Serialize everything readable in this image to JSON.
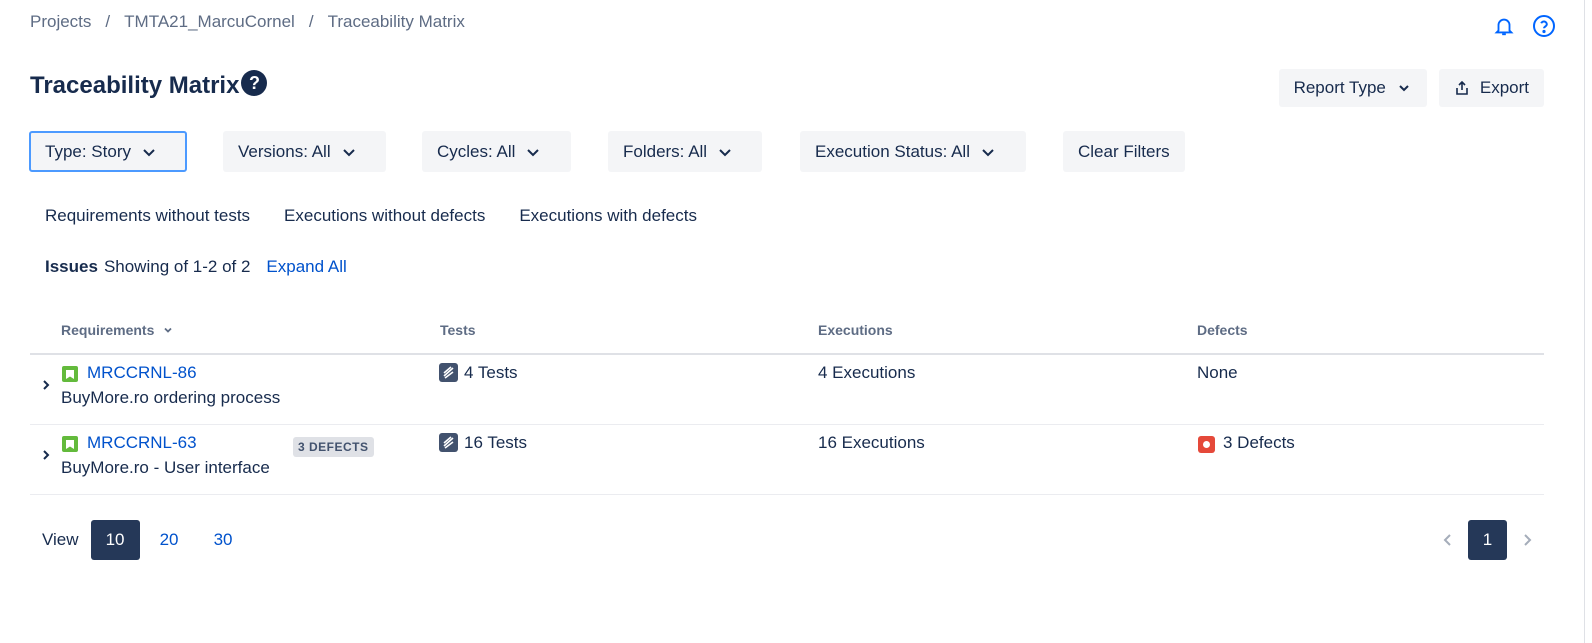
{
  "breadcrumb": {
    "items": [
      "Projects",
      "TMTA21_MarcuCornel",
      "Traceability Matrix"
    ],
    "separator": "/"
  },
  "header": {
    "title": "Traceability Matrix",
    "help_glyph": "?",
    "report_type_label": "Report Type",
    "export_label": "Export"
  },
  "filters": {
    "type": "Type: Story",
    "versions": "Versions: All",
    "cycles": "Cycles: All",
    "folders": "Folders: All",
    "execution_status": "Execution Status: All",
    "clear": "Clear Filters"
  },
  "quick_filters": [
    "Requirements without tests",
    "Executions without defects",
    "Executions with defects"
  ],
  "issues": {
    "label": "Issues",
    "showing": "Showing of 1-2 of 2",
    "expand_all": "Expand All"
  },
  "table": {
    "columns": [
      "Requirements",
      "Tests",
      "Executions",
      "Defects"
    ],
    "rows": [
      {
        "key": "MRCCRNL-86",
        "summary": "BuyMore.ro ordering process",
        "badge": "",
        "tests": "4 Tests",
        "executions": "4 Executions",
        "defects": "None"
      },
      {
        "key": "MRCCRNL-63",
        "summary": "BuyMore.ro - User interface",
        "badge": "3 DEFECTS",
        "tests": "16 Tests",
        "executions": "16 Executions",
        "defects": "3 Defects"
      }
    ]
  },
  "pager": {
    "view_label": "View",
    "options": [
      "10",
      "20",
      "30"
    ],
    "selected": "10",
    "current_page": "1"
  },
  "colors": {
    "accent": "#0052cc",
    "dark": "#253858",
    "story": "#63ba3c",
    "bug": "#e5493a",
    "focus": "#4c9aff"
  },
  "icons": [
    "bell-icon",
    "help-circle-icon",
    "chevron-down-icon",
    "export-icon",
    "story-icon",
    "tests-icon",
    "bug-icon",
    "chevron-right-icon",
    "chevron-left-icon"
  ]
}
